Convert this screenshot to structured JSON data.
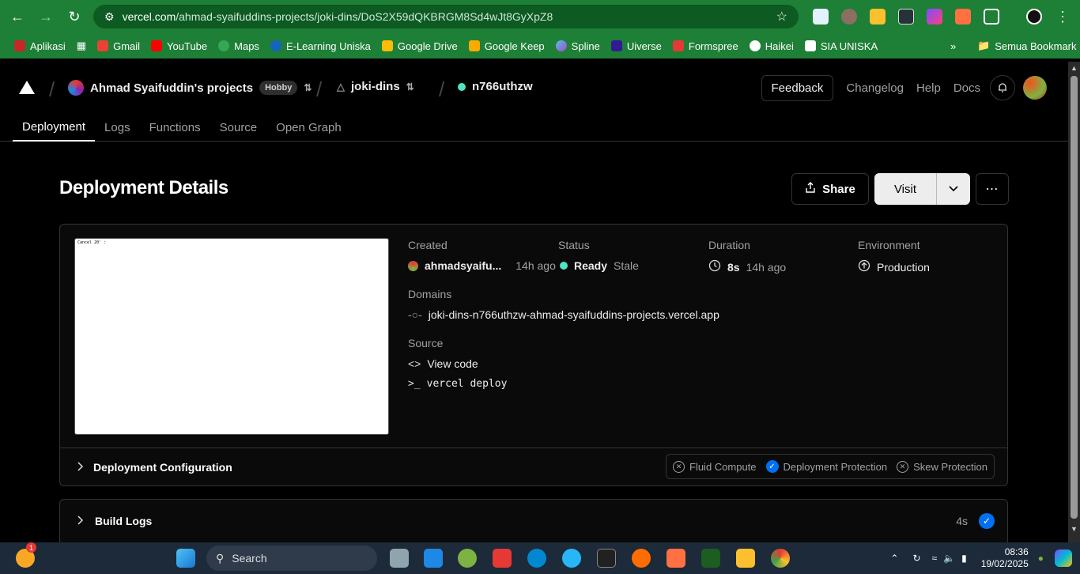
{
  "browser": {
    "url_host": "vercel.com",
    "url_path": "/ahmad-syaifuddins-projects/joki-dins/DoS2X59dQKBRGM8Sd4wJt8GyXpZ8",
    "bookmarks": [
      "Aplikasi",
      "Gmail",
      "YouTube",
      "Maps",
      "E-Learning Uniska",
      "Google Drive",
      "Google Keep",
      "Spline",
      "Uiverse",
      "Formspree",
      "Haikei",
      "SIA UNISKA"
    ],
    "all_bookmarks": "Semua Bookmark"
  },
  "header": {
    "team": "Ahmad Syaifuddin's projects",
    "plan": "Hobby",
    "project": "joki-dins",
    "deployment": "n766uthzw",
    "feedback": "Feedback",
    "changelog": "Changelog",
    "help": "Help",
    "docs": "Docs"
  },
  "tabs": [
    "Deployment",
    "Logs",
    "Functions",
    "Source",
    "Open Graph"
  ],
  "page": {
    "title": "Deployment Details",
    "share": "Share",
    "visit": "Visit"
  },
  "details": {
    "created_label": "Created",
    "created_user": "ahmadsyaifu...",
    "created_time": "14h ago",
    "status_label": "Status",
    "status_value": "Ready",
    "status_extra": "Stale",
    "duration_label": "Duration",
    "duration_value": "8s",
    "duration_ago": "14h ago",
    "environment_label": "Environment",
    "environment_value": "Production",
    "domains_label": "Domains",
    "domain": "joki-dins-n766uthzw-ahmad-syaifuddins-projects.vercel.app",
    "source_label": "Source",
    "view_code": "View code",
    "deploy_cmd": "vercel deploy",
    "preview_text": "Cancel 20' :"
  },
  "config": {
    "title": "Deployment Configuration",
    "fluid": "Fluid Compute",
    "protection": "Deployment Protection",
    "skew": "Skew Protection"
  },
  "build_logs": {
    "title": "Build Logs",
    "duration": "4s"
  },
  "taskbar": {
    "search": "Search",
    "time": "08:36",
    "date": "19/02/2025",
    "notif_count": "1"
  }
}
